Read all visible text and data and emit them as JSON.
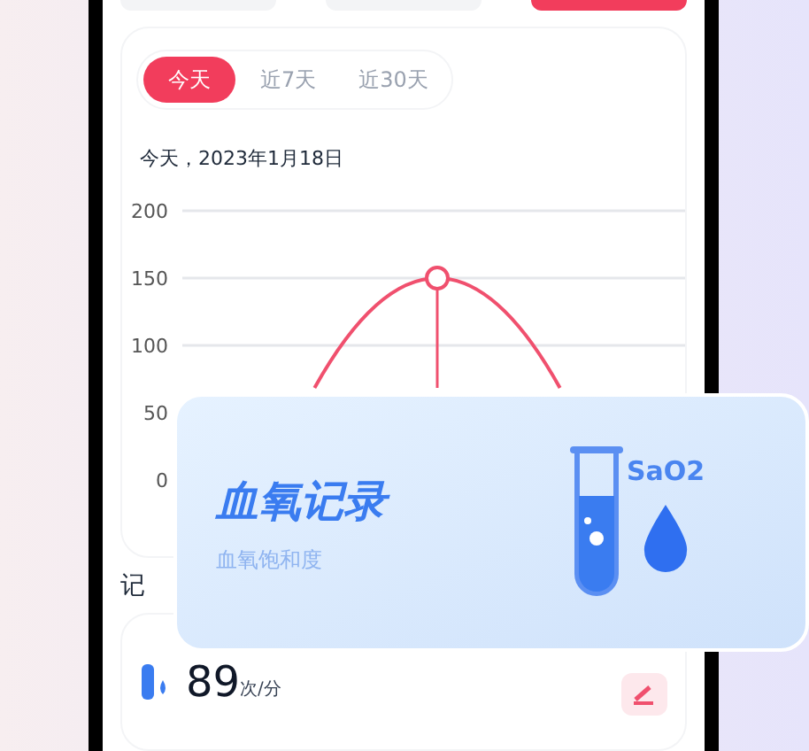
{
  "top_buttons": [
    {
      "selected": false
    },
    {
      "selected": false
    },
    {
      "selected": true
    }
  ],
  "range_tabs": [
    {
      "label": "今天",
      "selected": true
    },
    {
      "label": "近7天",
      "selected": false
    },
    {
      "label": "近30天",
      "selected": false
    }
  ],
  "date_label": "今天，2023年1月18日",
  "chart": {
    "y_axis_labels": [
      "200",
      "150",
      "100",
      "50",
      "0"
    ]
  },
  "section_title": "记",
  "record": {
    "value": "89",
    "unit": "次/分"
  },
  "feature_card": {
    "title": "血氧记录",
    "subtitle": "血氧饱和度",
    "badge": "SaO2"
  }
}
